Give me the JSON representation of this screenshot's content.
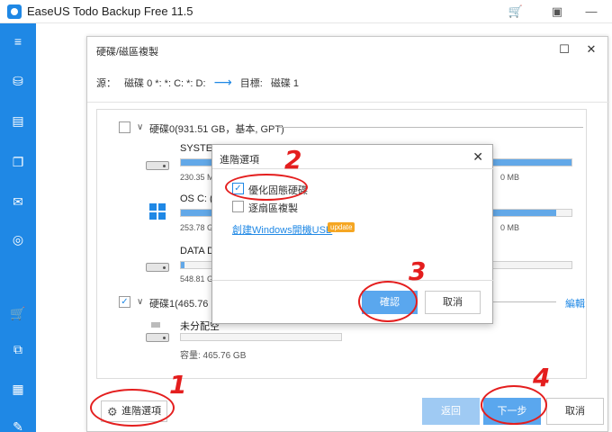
{
  "app": {
    "title": "EaseUS Todo Backup Free 11.5",
    "brand_color": "#1f88e5"
  },
  "titlebar_icons": [
    "cart-icon",
    "dropdown-icon",
    "minimize-icon"
  ],
  "sidebar": {
    "icons": [
      "menu-icon",
      "disk-backup-icon",
      "system-backup-icon",
      "file-backup-icon",
      "mail-backup-icon",
      "target-icon",
      "cart-icon",
      "clone-icon",
      "tools-icon",
      "wrench-icon"
    ]
  },
  "clone_dialog": {
    "title": "硬碟/磁區複製",
    "source_label": "源：",
    "source_value": "磁碟 0 *: *: C: *: D:",
    "target_label": "目標:",
    "target_value": "磁碟 1",
    "disk0": {
      "label": "硬碟0(931.51 GB，基本, GPT)"
    },
    "partitions": [
      {
        "name": "SYSTEM",
        "size": "230.35 M",
        "size_right": "0 MB",
        "fill": 1.0
      },
      {
        "name": "OS C: (N",
        "size": "253.78 G",
        "size_right": "0 MB",
        "fill": 0.96
      },
      {
        "name": "DATA D",
        "size": "548.81 G",
        "size_right": "",
        "fill": 0.01
      }
    ],
    "disk1": {
      "label": "硬碟1(465.76 G"
    },
    "unallocated": {
      "name": "未分配空",
      "capacity": "容量: 465.76 GB"
    },
    "edit_link": "編輯",
    "buttons": {
      "advanced": "進階選項",
      "back": "返回",
      "next": "下一步",
      "cancel": "取消"
    }
  },
  "advanced_popup": {
    "title": "進階選項",
    "option_ssd": "優化固態硬碟",
    "option_sector": "逐扇區複製",
    "usb_link": "創建Windows開機USB",
    "badge": "update",
    "ok": "確認",
    "cancel": "取消"
  },
  "annotations": [
    "1",
    "2",
    "3",
    "4"
  ],
  "annotation_color": "#e41e1e"
}
